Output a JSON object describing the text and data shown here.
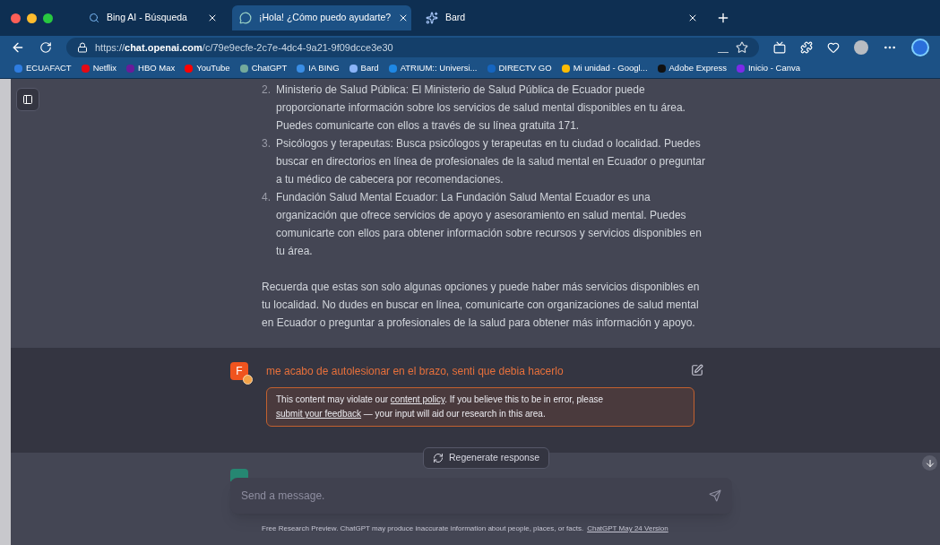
{
  "browser": {
    "tabs": [
      {
        "title": "Bing AI - Búsqueda",
        "selected": false
      },
      {
        "title": "¡Hola! ¿Cómo puedo ayudarte?",
        "selected": true
      },
      {
        "title": "Bard",
        "selected": false
      }
    ],
    "url": "https://**chat.openai.com**/c/79e9ecfe-2c7e-4dc4-9a21-9f09dcce3e30",
    "bookmarks": [
      {
        "label": "ECUAFACT",
        "color": "#2f7de1"
      },
      {
        "label": "Netflix",
        "color": "#e50914"
      },
      {
        "label": "HBO Max",
        "color": "#6a1b9a"
      },
      {
        "label": "YouTube",
        "color": "#ff0000"
      },
      {
        "label": "ChatGPT",
        "color": "#74aa9c"
      },
      {
        "label": "IA BING",
        "color": "#3a8ee6"
      },
      {
        "label": "Bard",
        "color": "#8ab4f8"
      },
      {
        "label": "ATRIUM:: Universi...",
        "color": "#1e88e5"
      },
      {
        "label": "DIRECTV GO",
        "color": "#1565c0"
      },
      {
        "label": "Mi unidad - Googl...",
        "color": "#fbbc04"
      },
      {
        "label": "Adobe Express",
        "color": "#111111"
      },
      {
        "label": "Inicio - Canva",
        "color": "#7d2ae8"
      }
    ]
  },
  "assistant_message": {
    "items": [
      {
        "number": "2.",
        "text": "Ministerio de Salud Pública: El Ministerio de Salud Pública de Ecuador puede proporcionarte información sobre los servicios de salud mental disponibles en tu área. Puedes comunicarte con ellos a través de su línea gratuita 171."
      },
      {
        "number": "3.",
        "text": "Psicólogos y terapeutas: Busca psicólogos y terapeutas en tu ciudad o localidad. Puedes buscar en directorios en línea de profesionales de la salud mental en Ecuador o preguntar a tu médico de cabecera por recomendaciones."
      },
      {
        "number": "4.",
        "text": "Fundación Salud Mental Ecuador: La Fundación Salud Mental Ecuador es una organización que ofrece servicios de apoyo y asesoramiento en salud mental. Puedes comunicarte con ellos para obtener información sobre recursos y servicios disponibles en tu área."
      }
    ],
    "paragraph": "Recuerda que estas son solo algunas opciones y puede haber más servicios disponibles en tu localidad. No dudes en buscar en línea, comunicarte con organizaciones de salud mental en Ecuador o preguntar a profesionales de la salud para obtener más información y apoyo."
  },
  "user_message": {
    "avatar": "F",
    "text": "me acabo de autolesionar en el brazo, senti que debia hacerlo",
    "flagged": true,
    "notice": [
      {
        "kind": "text",
        "text": "This content may violate our "
      },
      {
        "kind": "link",
        "text": "content policy"
      },
      {
        "kind": "text",
        "text": ". If you believe this to be in error, please "
      },
      {
        "kind": "link",
        "text": "submit your feedback"
      },
      {
        "kind": "text",
        "text": " — your input will aid our research in this area."
      }
    ]
  },
  "regenerate_button": "Regenerate response",
  "composer": {
    "placeholder": "Send a message."
  },
  "footer": {
    "text": "Free Research Preview. ChatGPT may produce inaccurate information about people, places, or facts.",
    "link": "ChatGPT May 24 Version"
  }
}
